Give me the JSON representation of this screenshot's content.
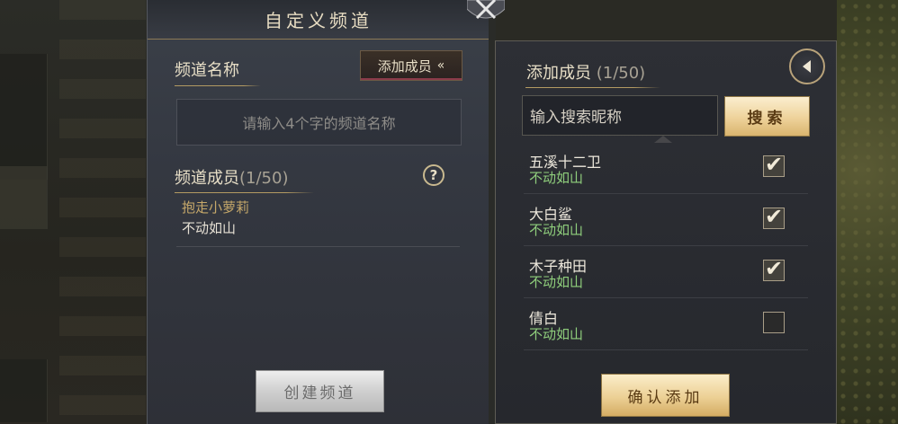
{
  "background": {
    "tabs": [
      "",
      "",
      " ",
      ""
    ],
    "messages": [],
    "tab_labels": [
      "",
      "",
      ""
    ]
  },
  "left_panel": {
    "title": "自定义频道",
    "channel_name_label": "频道名称",
    "add_members_button": "添加成员",
    "add_members_chevron": "«",
    "channel_name_placeholder": "请输入4个字的频道名称",
    "members_label": "频道成员",
    "members_count": "(1/50)",
    "help_symbol": "?",
    "member": {
      "name": "抱走小萝莉",
      "tag": "不动如山"
    },
    "create_button": "创建频道"
  },
  "right_panel": {
    "title": "添加成员",
    "count": "(1/50)",
    "search_placeholder": "输入搜索昵称",
    "search_button": "搜索",
    "members": [
      {
        "name": "五溪十二卫",
        "tag": "不动如山",
        "checked": true
      },
      {
        "name": "大白鲨",
        "tag": "不动如山",
        "checked": true
      },
      {
        "name": "木子种田",
        "tag": "不动如山",
        "checked": true
      },
      {
        "name": "倩白",
        "tag": "不动如山",
        "checked": false
      }
    ],
    "confirm_button": "确认添加"
  },
  "icons": {
    "close": "close-icon",
    "back": "back-arrow-icon",
    "help": "help-icon",
    "check": "✔"
  },
  "colors": {
    "gold_button": "#ecd095",
    "tag_green": "#8fce7c",
    "member_gold": "#c6a86a"
  }
}
